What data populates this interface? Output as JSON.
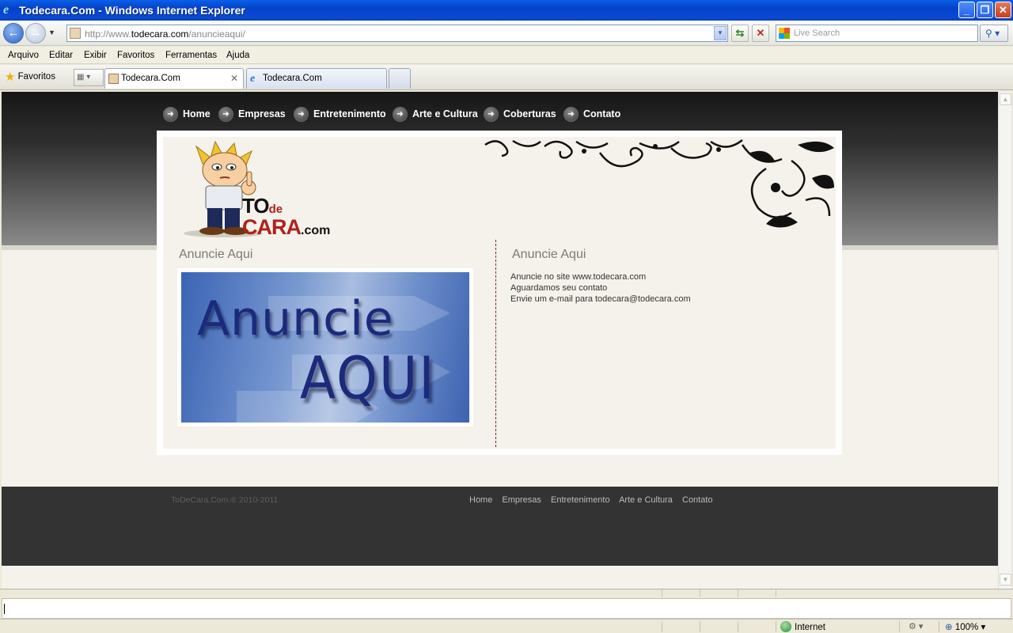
{
  "window": {
    "title": "Todecara.Com - Windows Internet Explorer",
    "minimize": "_",
    "restore": "❐",
    "close": "✕"
  },
  "address": {
    "url_prefix": "http://www.",
    "url_domain": "todecara.com",
    "url_path": "/anuncieaqui/",
    "search_placeholder": "Live Search"
  },
  "menu": [
    "Arquivo",
    "Editar",
    "Exibir",
    "Favoritos",
    "Ferramentas",
    "Ajuda"
  ],
  "favorites_label": "Favoritos",
  "tabs": [
    {
      "label": "Todecara.Com",
      "active": true
    },
    {
      "label": "Todecara.Com",
      "active": false
    }
  ],
  "site": {
    "nav": [
      "Home",
      "Empresas",
      "Entretenimento",
      "Arte e Cultura",
      "Coberturas",
      "Contato"
    ],
    "logo": {
      "to": "TO",
      "de": "de",
      "cara": "CARA",
      "com": ".com"
    },
    "left_heading": "Anuncie Aqui",
    "ad_banner": {
      "line1": "Anuncie",
      "line2": "AQUI"
    },
    "right_heading": "Anuncie Aqui",
    "right_lines": [
      "Anuncie no site www.todecara.com",
      "Aguardamos seu contato",
      "Envie um e-mail para todecara@todecara.com"
    ],
    "footer": {
      "copyright": "ToDeCara.Com.® 2010-2011",
      "links": [
        "Home",
        "Empresas",
        "Entretenimento",
        "Arte e Cultura",
        "Contato"
      ]
    }
  },
  "status": {
    "zone": "Internet",
    "zoom": "100%"
  }
}
